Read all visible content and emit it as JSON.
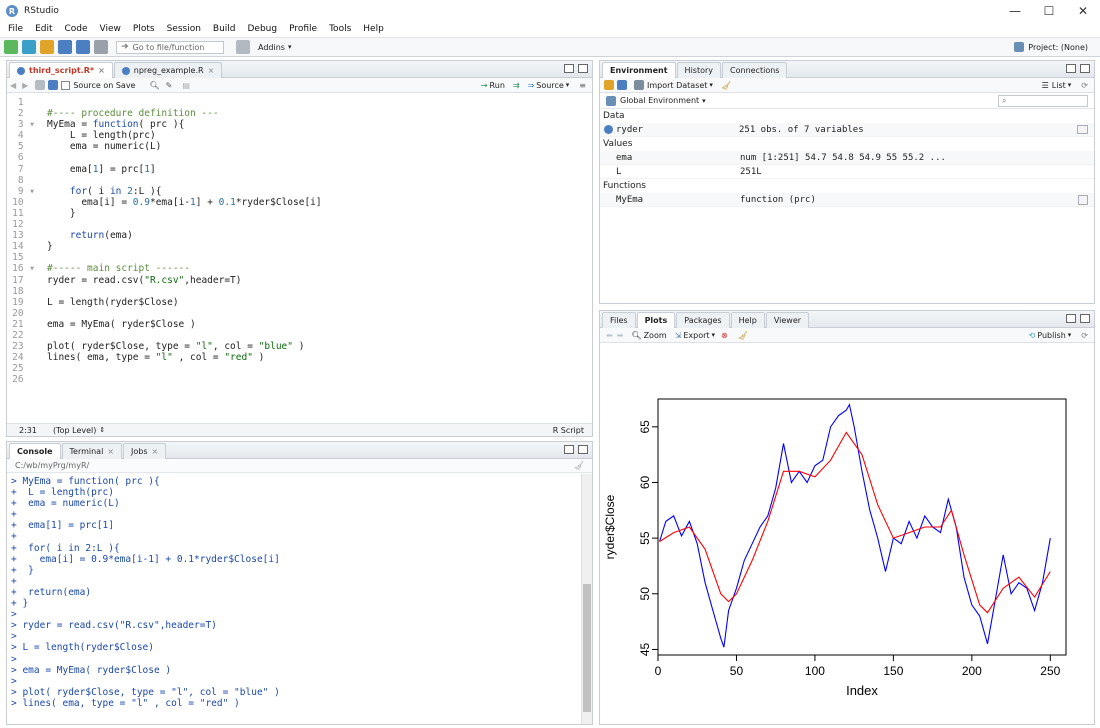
{
  "window": {
    "title": "RStudio",
    "controls": {
      "minimize": "—",
      "maximize": "☐",
      "close": "✕"
    }
  },
  "menu": [
    "File",
    "Edit",
    "Code",
    "View",
    "Plots",
    "Session",
    "Build",
    "Debug",
    "Profile",
    "Tools",
    "Help"
  ],
  "toolbar": {
    "goto_placeholder": "Go to file/function",
    "addins": "Addins",
    "project": "Project: (None)"
  },
  "editor": {
    "tabs": [
      {
        "label": "third_script.R*",
        "active": true
      },
      {
        "label": "npreg_example.R",
        "active": false
      }
    ],
    "source_on_save": "Source on Save",
    "run": "Run",
    "source": "Source",
    "status_pos": "2:31",
    "status_scope": "(Top Level)",
    "status_type": "R Script",
    "lines": [
      "",
      "#---- procedure definition ---",
      "MyEma = function( prc ){",
      "    L = length(prc)",
      "    ema = numeric(L)",
      "",
      "    ema[1] = prc[1]",
      "",
      "    for( i in 2:L ){",
      "      ema[i] = 0.9*ema[i-1] + 0.1*ryder$Close[i]",
      "    }",
      "",
      "    return(ema)",
      "}",
      "",
      "#----- main script ------",
      "ryder = read.csv(\"R.csv\",header=T)",
      "",
      "L = length(ryder$Close)",
      "",
      "ema = MyEma( ryder$Close )",
      "",
      "plot( ryder$Close, type = \"l\", col = \"blue\" )",
      "lines( ema, type = \"l\" , col = \"red\" )",
      "",
      ""
    ]
  },
  "console": {
    "tabs": [
      {
        "label": "Console",
        "active": true
      },
      {
        "label": "Terminal",
        "active": false
      },
      {
        "label": "Jobs",
        "active": false
      }
    ],
    "path": "C:/wb/myPrg/myR/",
    "lines": [
      "> MyEma = function( prc ){",
      "+  L = length(prc)",
      "+  ema = numeric(L)",
      "+",
      "+  ema[1] = prc[1]",
      "+",
      "+  for( i in 2:L ){",
      "+    ema[i] = 0.9*ema[i-1] + 0.1*ryder$Close[i]",
      "+  }",
      "+",
      "+  return(ema)",
      "+ }",
      ">",
      "> ryder = read.csv(\"R.csv\",header=T)",
      ">",
      "> L = length(ryder$Close)",
      ">",
      "> ema = MyEma( ryder$Close )",
      ">",
      "> plot( ryder$Close, type = \"l\", col = \"blue\" )",
      "> lines( ema, type = \"l\" , col = \"red\" )"
    ]
  },
  "environment": {
    "tabs": [
      {
        "label": "Environment",
        "active": true
      },
      {
        "label": "History",
        "active": false
      },
      {
        "label": "Connections",
        "active": false
      }
    ],
    "import_dataset": "Import Dataset",
    "list_label": "List",
    "global_env": "Global Environment",
    "sections": {
      "data": "Data",
      "values": "Values",
      "functions": "Functions"
    },
    "data_rows": [
      {
        "name": "ryder",
        "value": "251 obs. of 7 variables"
      }
    ],
    "value_rows": [
      {
        "name": "ema",
        "value": "num [1:251] 54.7 54.8 54.9 55 55.2 ..."
      },
      {
        "name": "L",
        "value": "251L"
      }
    ],
    "function_rows": [
      {
        "name": "MyEma",
        "value": "function (prc)"
      }
    ]
  },
  "files_pane": {
    "tabs": [
      {
        "label": "Files",
        "active": false
      },
      {
        "label": "Plots",
        "active": true
      },
      {
        "label": "Packages",
        "active": false
      },
      {
        "label": "Help",
        "active": false
      },
      {
        "label": "Viewer",
        "active": false
      }
    ],
    "zoom": "Zoom",
    "export": "Export",
    "publish": "Publish"
  },
  "chart_data": {
    "type": "line",
    "xlabel": "Index",
    "ylabel": "ryder$Close",
    "xlim": [
      0,
      260
    ],
    "ylim": [
      44.5,
      67.5
    ],
    "xticks": [
      0,
      50,
      100,
      150,
      200,
      250
    ],
    "yticks": [
      45,
      50,
      55,
      60,
      65
    ],
    "series": [
      {
        "color": "#0000ff",
        "points": [
          [
            1,
            54.7
          ],
          [
            5,
            56.5
          ],
          [
            10,
            57
          ],
          [
            15,
            55.2
          ],
          [
            20,
            56.5
          ],
          [
            25,
            54.5
          ],
          [
            30,
            51
          ],
          [
            35,
            48.5
          ],
          [
            40,
            46
          ],
          [
            42,
            45.2
          ],
          [
            45,
            48.5
          ],
          [
            50,
            50.5
          ],
          [
            55,
            53
          ],
          [
            60,
            54.5
          ],
          [
            65,
            56
          ],
          [
            70,
            57
          ],
          [
            75,
            59.5
          ],
          [
            80,
            63.5
          ],
          [
            85,
            60
          ],
          [
            90,
            61
          ],
          [
            95,
            60
          ],
          [
            100,
            61.5
          ],
          [
            105,
            62
          ],
          [
            110,
            65
          ],
          [
            115,
            66
          ],
          [
            120,
            66.5
          ],
          [
            122,
            67
          ],
          [
            125,
            65
          ],
          [
            130,
            61
          ],
          [
            135,
            57.5
          ],
          [
            138,
            56
          ],
          [
            140,
            55
          ],
          [
            145,
            52
          ],
          [
            150,
            55
          ],
          [
            155,
            54.5
          ],
          [
            160,
            56.5
          ],
          [
            165,
            55
          ],
          [
            170,
            57
          ],
          [
            175,
            56
          ],
          [
            180,
            55.5
          ],
          [
            185,
            58.5
          ],
          [
            190,
            56
          ],
          [
            195,
            51.5
          ],
          [
            200,
            49
          ],
          [
            205,
            48
          ],
          [
            210,
            45.5
          ],
          [
            215,
            49.5
          ],
          [
            220,
            53.5
          ],
          [
            225,
            50
          ],
          [
            230,
            51
          ],
          [
            235,
            50.5
          ],
          [
            240,
            48.5
          ],
          [
            245,
            51
          ],
          [
            250,
            55
          ]
        ]
      },
      {
        "color": "#ff0000",
        "points": [
          [
            1,
            54.7
          ],
          [
            10,
            55.5
          ],
          [
            20,
            56
          ],
          [
            30,
            54
          ],
          [
            40,
            50
          ],
          [
            45,
            49.3
          ],
          [
            50,
            50
          ],
          [
            60,
            53
          ],
          [
            70,
            56.5
          ],
          [
            80,
            61
          ],
          [
            90,
            61
          ],
          [
            100,
            60.5
          ],
          [
            110,
            62
          ],
          [
            120,
            64.5
          ],
          [
            130,
            62.5
          ],
          [
            140,
            58
          ],
          [
            150,
            55
          ],
          [
            160,
            55.5
          ],
          [
            170,
            56
          ],
          [
            180,
            56
          ],
          [
            187,
            57.5
          ],
          [
            195,
            53.5
          ],
          [
            205,
            49
          ],
          [
            210,
            48.3
          ],
          [
            220,
            50.5
          ],
          [
            230,
            51.5
          ],
          [
            240,
            49.7
          ],
          [
            250,
            52
          ]
        ]
      }
    ]
  }
}
